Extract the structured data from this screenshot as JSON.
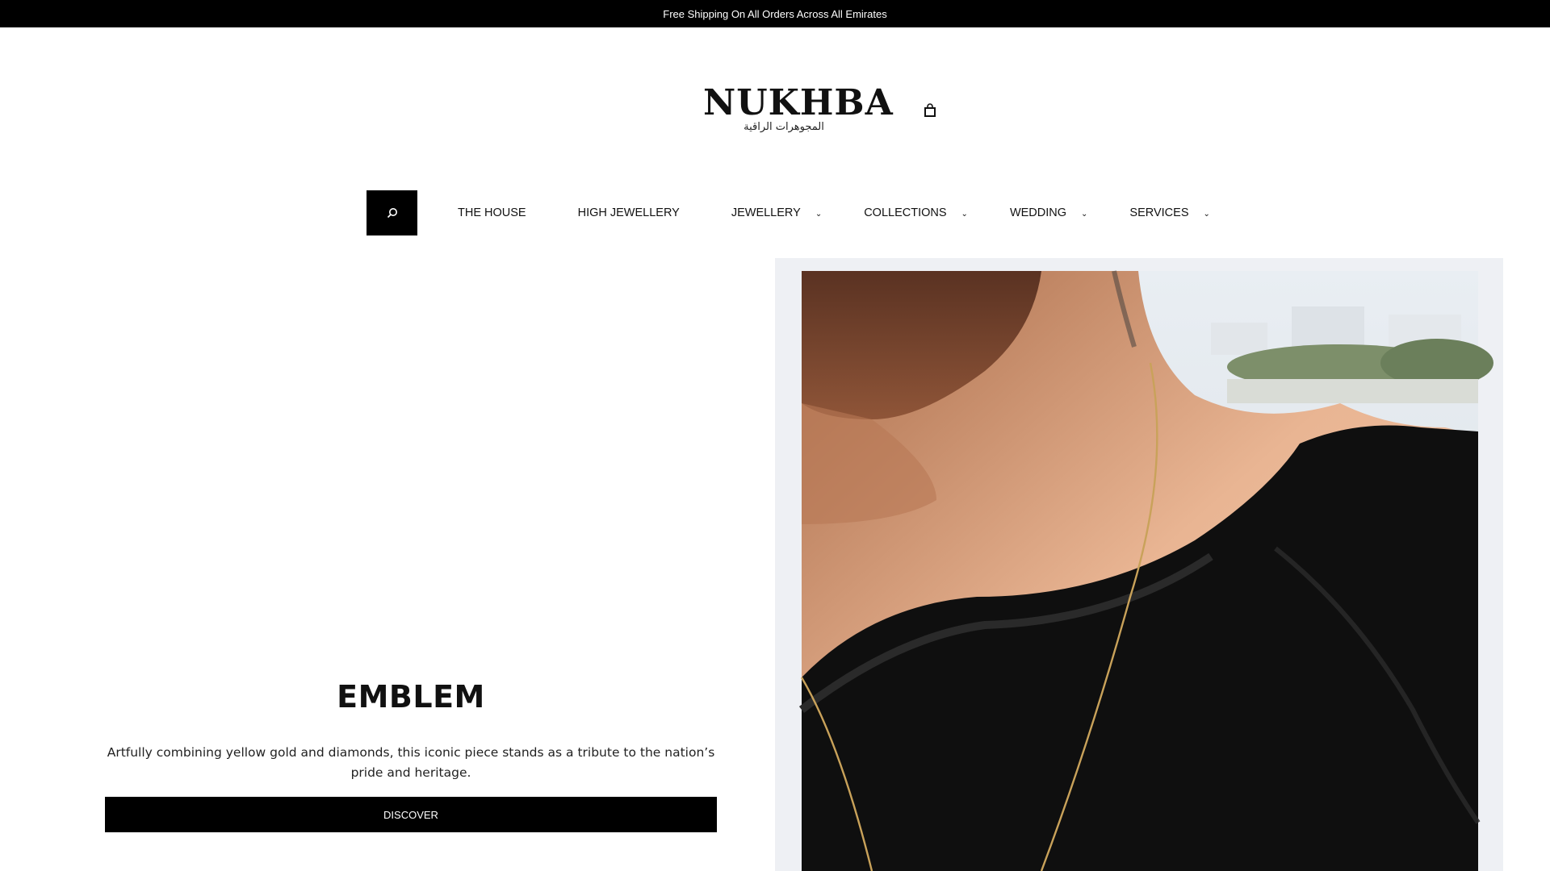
{
  "announcement": {
    "text": "Free Shipping On All Orders Across All Emirates"
  },
  "brand": {
    "name": "NUKHBA",
    "tagline": "المجوهرات الراقية"
  },
  "header": {
    "cart_icon": "shopping-bag-icon",
    "search_icon": "search-icon"
  },
  "nav": {
    "items": [
      {
        "label": "THE HOUSE",
        "has_dropdown": false
      },
      {
        "label": "HIGH JEWELLERY",
        "has_dropdown": false
      },
      {
        "label": "JEWELLERY",
        "has_dropdown": true
      },
      {
        "label": "COLLECTIONS",
        "has_dropdown": true
      },
      {
        "label": "WEDDING",
        "has_dropdown": true
      },
      {
        "label": "SERVICES",
        "has_dropdown": true
      }
    ],
    "chevron": "⌄"
  },
  "hero": {
    "title": "EMBLEM",
    "description": "Artfully combining yellow gold and diamonds, this iconic piece stands as a tribute to the nation’s pride and heritage.",
    "cta_label": "DISCOVER"
  },
  "colors": {
    "black": "#000000",
    "white": "#ffffff",
    "image_frame": "#eef0f4"
  }
}
